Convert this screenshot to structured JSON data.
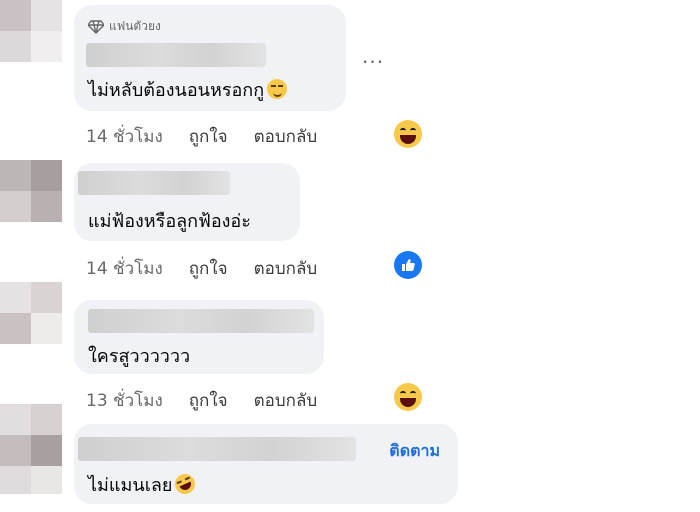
{
  "comments": [
    {
      "badge": "แฟนตัวยง",
      "text": "ไม่หลับต้องนอนหรอกกู",
      "text_emoji": "smirk-emoji",
      "time": "14 ชั่วโมง",
      "like_label": "ถูกใจ",
      "reply_label": "ตอบกลับ",
      "reaction": "haha-reaction",
      "more_label": "···"
    },
    {
      "text": "แม่ฟ้องหรือลูกฟ้องอ่ะ",
      "time": "14 ชั่วโมง",
      "like_label": "ถูกใจ",
      "reply_label": "ตอบกลับ",
      "reaction": "like-reaction"
    },
    {
      "text": "ใครสูวววววว",
      "time": "13 ชั่วโมง",
      "like_label": "ถูกใจ",
      "reply_label": "ตอบกลับ",
      "reaction": "haha-reaction"
    },
    {
      "text": "ไม่แมนเลย",
      "text_emoji": "rofl-emoji",
      "follow_label": "ติดตาม"
    }
  ],
  "colors": {
    "bubble": "#f0f2f5",
    "meta_text": "#65676b",
    "follow_link": "#216fdb",
    "like_blue": "#1877f2"
  }
}
